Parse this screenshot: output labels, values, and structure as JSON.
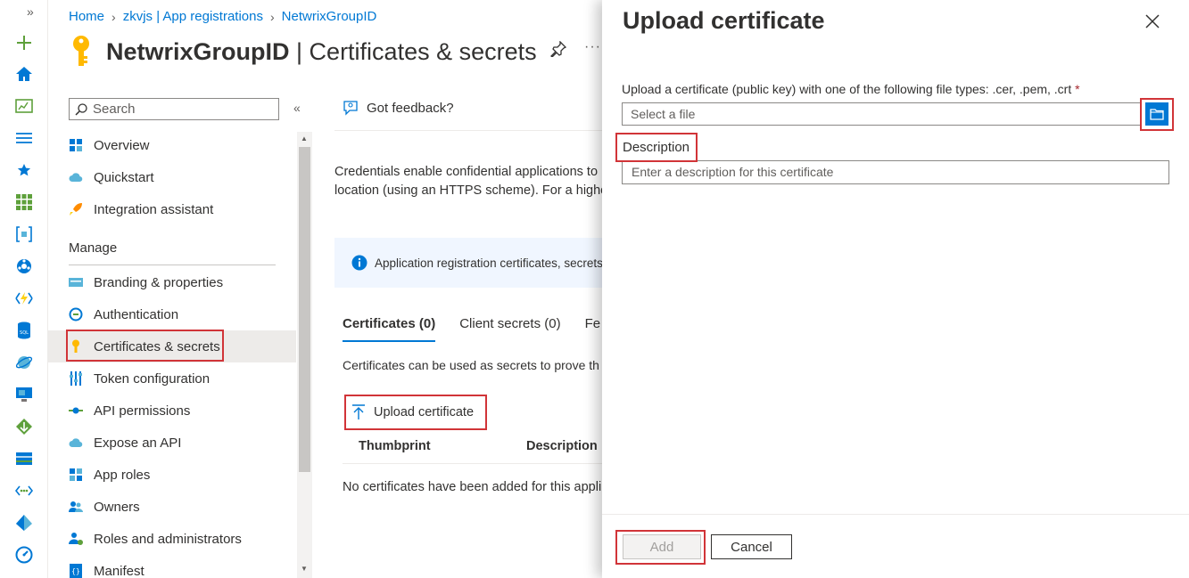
{
  "breadcrumb": {
    "items": [
      "Home",
      "zkvjs | App registrations",
      "NetwrixGroupID"
    ]
  },
  "header": {
    "title_bold": "NetwrixGroupID",
    "title_rest": " | Certificates & secrets"
  },
  "left_nav": {
    "search_placeholder": "Search",
    "items_top": [
      "Overview",
      "Quickstart",
      "Integration assistant"
    ],
    "section_label": "Manage",
    "items_manage": [
      "Branding & properties",
      "Authentication",
      "Certificates & secrets",
      "Token configuration",
      "API permissions",
      "Expose an API",
      "App roles",
      "Owners",
      "Roles and administrators",
      "Manifest"
    ],
    "active_item": "Certificates & secrets"
  },
  "main": {
    "feedback": "Got feedback?",
    "description_line1": "Credentials enable confidential applications to",
    "description_line2": "location (using an HTTPS scheme). For a higher",
    "info_bar": "Application registration certificates, secrets",
    "tabs": [
      "Certificates (0)",
      "Client secrets (0)",
      "Fe"
    ],
    "tab_info": "Certificates can be used as secrets to prove th",
    "upload_button": "Upload certificate",
    "table_headers": [
      "Thumbprint",
      "Description"
    ],
    "empty_message": "No certificates have been added for this appli"
  },
  "panel": {
    "title": "Upload certificate",
    "upload_label": "Upload a certificate (public key) with one of the following file types: .cer, .pem, .crt",
    "required_marker": "*",
    "file_placeholder": "Select a file",
    "description_label": "Description",
    "description_placeholder": "Enter a description for this certificate",
    "add_button": "Add",
    "cancel_button": "Cancel"
  },
  "colors": {
    "accent": "#0078d4",
    "highlight": "#d13438",
    "key_yellow": "#ffb900"
  }
}
